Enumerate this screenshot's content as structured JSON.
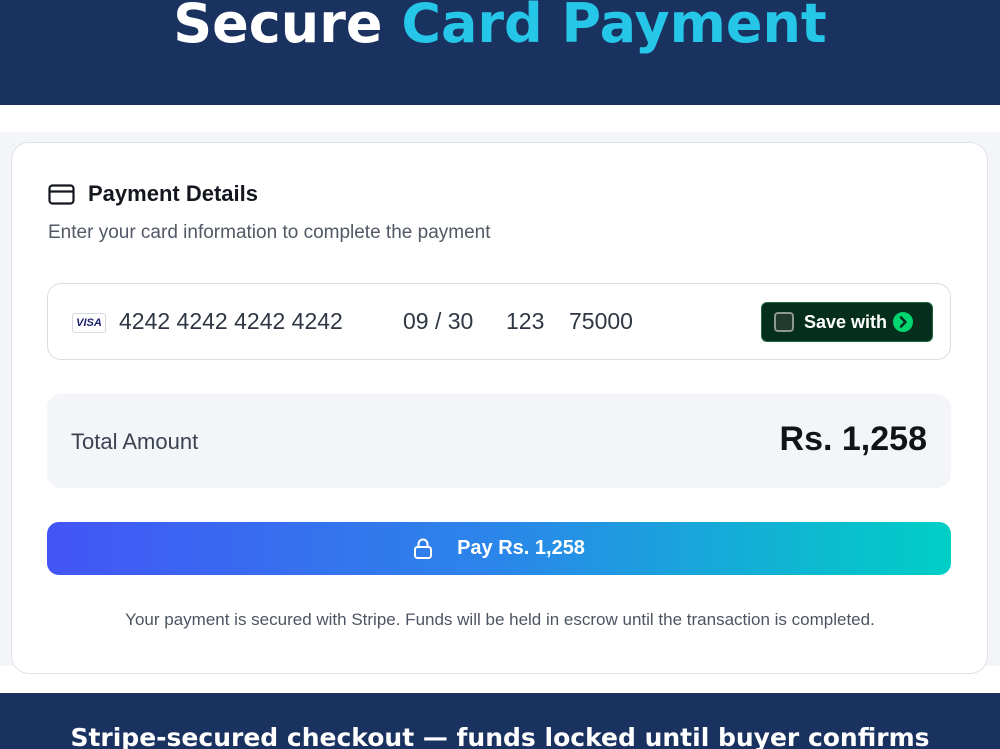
{
  "banner": {
    "title_part1": "Secure",
    "title_part2": "Card Payment",
    "accent_color": "#26c6e8",
    "background_color": "#1a3260"
  },
  "payment_details": {
    "icon": "credit-card-icon",
    "title": "Payment Details",
    "subtitle": "Enter your card information to complete the payment"
  },
  "card_field": {
    "brand_icon": "visa-icon",
    "brand_label": "VISA",
    "card_number": "4242 4242 4242 4242",
    "expiry": "09 / 30",
    "cvc": "123",
    "zip": "75000",
    "save_button": {
      "label": "Save with",
      "checked": false,
      "icon": "link-arrow-icon",
      "icon_color": "#00d66f"
    }
  },
  "total": {
    "label": "Total Amount",
    "value": "Rs. 1,258"
  },
  "pay_button": {
    "icon": "lock-icon",
    "label": "Pay Rs. 1,258"
  },
  "secure_note": "Your payment is secured with Stripe. Funds will be held in escrow until the transaction is completed.",
  "footer_banner": {
    "text": "Stripe-secured checkout — funds locked until buyer confirms"
  }
}
